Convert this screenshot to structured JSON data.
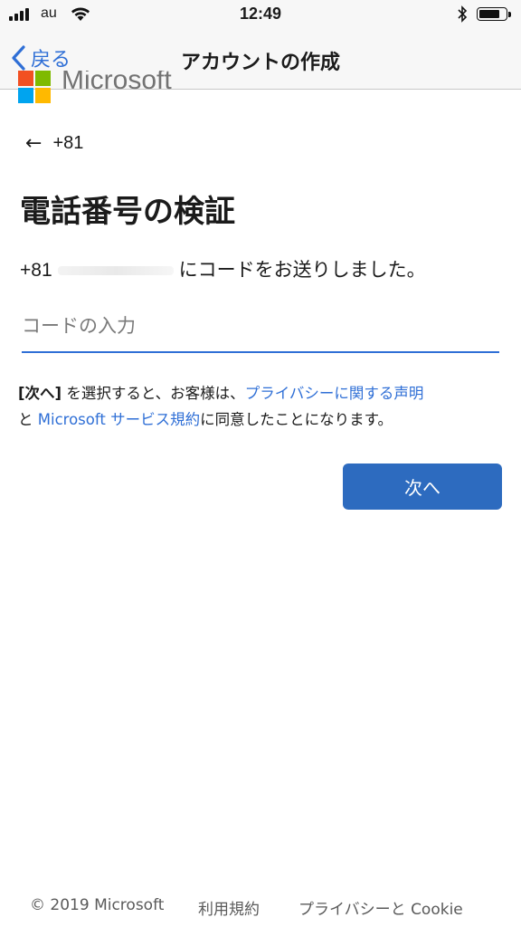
{
  "status_bar": {
    "carrier": "au",
    "time": "12:49",
    "battery_level": 0.85
  },
  "nav": {
    "back_label": "戻る",
    "title": "アカウントの作成"
  },
  "logo": {
    "text": "Microsoft",
    "colors": [
      "#f25022",
      "#7fba00",
      "#00a4ef",
      "#ffb900"
    ]
  },
  "identity": {
    "back_arrow": "←",
    "number": "+81"
  },
  "page_title": "電話番号の検証",
  "sent_message": {
    "prefix": "+81",
    "suffix": "にコードをお送りしました。"
  },
  "code_input": {
    "placeholder": "コードの入力",
    "value": ""
  },
  "terms": {
    "next_ref": "[次へ]",
    "part1": " を選択すると、お客様は、",
    "privacy_link": "プライバシーに関する声明",
    "part2": "と ",
    "services_link": "Microsoft サービス規約",
    "part3": "に同意したことになります。"
  },
  "next_button": "次へ",
  "footer": {
    "copyright": "© 2019 Microsoft",
    "terms_link": "利用規約",
    "privacy_link": "プライバシーと Cookie"
  },
  "colors": {
    "accent": "#2f6fd6",
    "button": "#2d6bbf"
  }
}
